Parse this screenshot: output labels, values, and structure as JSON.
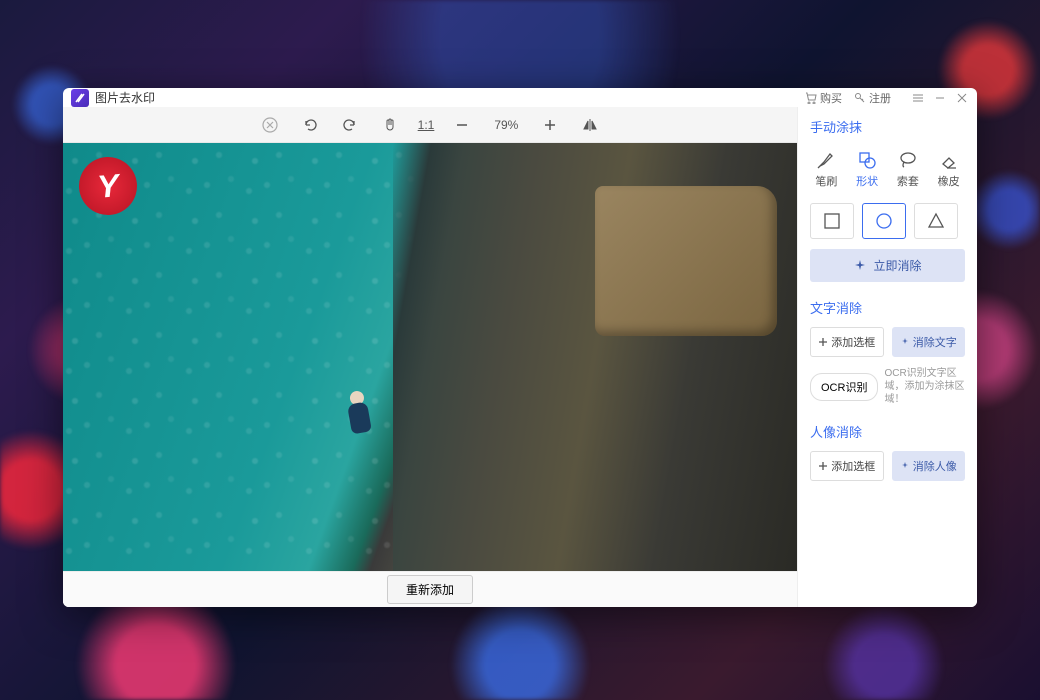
{
  "app": {
    "title": "图片去水印"
  },
  "titlebar": {
    "buy": "购买",
    "register": "注册"
  },
  "toolbar": {
    "zoom": "79%"
  },
  "footer": {
    "readd": "重新添加"
  },
  "sidebar": {
    "manual": {
      "title": "手动涂抹",
      "tools": {
        "brush": "笔刷",
        "shape": "形状",
        "lasso": "索套",
        "eraser": "橡皮"
      },
      "eraseNow": "立即消除"
    },
    "text": {
      "title": "文字消除",
      "addBox": "添加选框",
      "eraseText": "消除文字",
      "ocr": "OCR识别",
      "ocrHint": "OCR识别文字区域，添加为涂抹区域！"
    },
    "portrait": {
      "title": "人像消除",
      "addBox": "添加选框",
      "erasePortrait": "消除人像"
    }
  },
  "image": {
    "watermarkLogo": "Y"
  }
}
